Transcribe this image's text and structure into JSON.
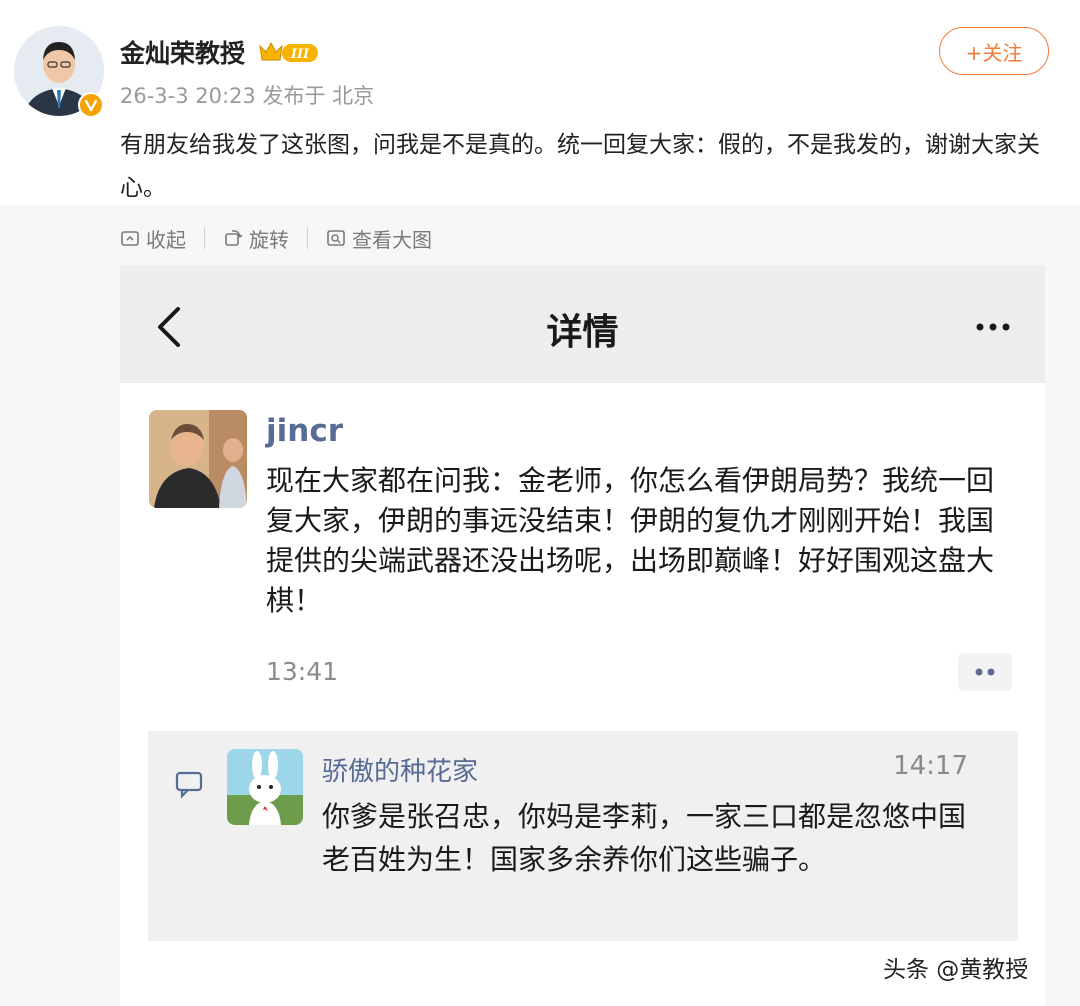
{
  "post": {
    "author": "金灿荣教授",
    "level_badge": "III",
    "timestamp": "26-3-3 20:23",
    "published_from": "发布于 北京",
    "follow_label": "+关注",
    "text": "有朋友给我发了这张图，问我是不是真的。统一回复大家：假的，不是我发的，谢谢大家关心。"
  },
  "image_toolbar": {
    "collapse_label": "收起",
    "rotate_label": "旋转",
    "view_large_label": "查看大图"
  },
  "screenshot": {
    "title": "详情",
    "moment": {
      "author": "jincr",
      "text": "现在大家都在问我：金老师，你怎么看伊朗局势？我统一回复大家，伊朗的事远没结束！伊朗的复仇才刚刚开始！我国提供的尖端武器还没出场呢，出场即巅峰！好好围观这盘大棋！",
      "time": "13:41"
    },
    "comment": {
      "author": "骄傲的种花家",
      "time": "14:17",
      "text": "你爹是张召忠，你妈是李莉，一家三口都是忽悠中国老百姓为生！国家多余养你们这些骗子。"
    }
  },
  "watermark": "头条 @黄教授",
  "colors": {
    "follow_accent": "#f07c3a",
    "wechat_name_blue": "#576b95",
    "verified_orange": "#f5a300"
  },
  "icons": [
    "verified-icon",
    "collapse-icon",
    "rotate-icon",
    "view-large-icon",
    "back-icon",
    "more-icon",
    "like-dots-icon",
    "comment-icon"
  ]
}
